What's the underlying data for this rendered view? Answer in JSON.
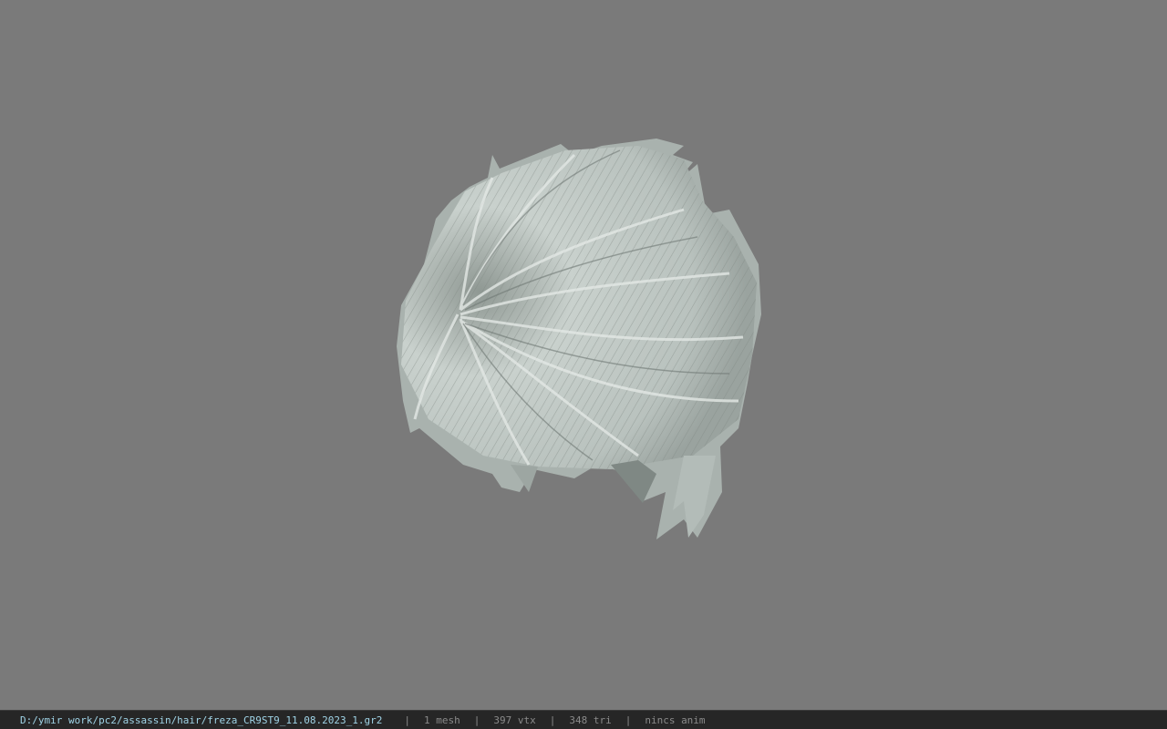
{
  "viewport": {
    "background_color": "#7a7a7a",
    "model_icon": "hair-mesh-render"
  },
  "status_bar": {
    "file_path": "D:/ymir work/pc2/assassin/hair/freza_CR9ST9_11.08.2023_1.gr2",
    "separator": "|",
    "mesh_count": "1 mesh",
    "vertex_count": "397 vtx",
    "triangle_count": "348 tri",
    "anim_status": "nincs anim",
    "path_color": "#9fd3e6",
    "text_color": "#8a8a8a"
  }
}
